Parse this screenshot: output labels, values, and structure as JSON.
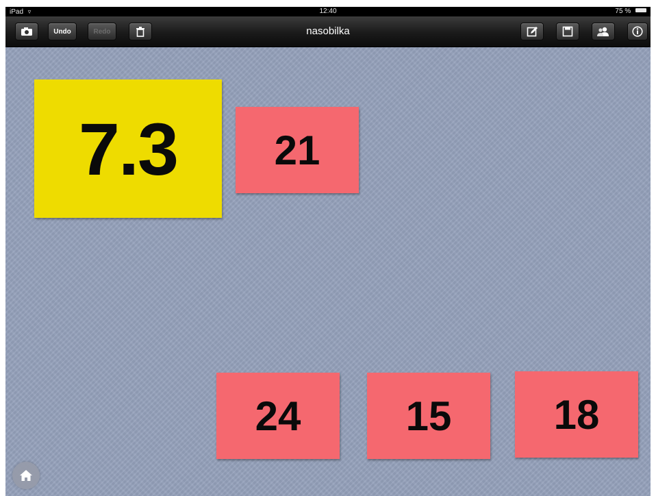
{
  "status_bar": {
    "device": "iPad",
    "time": "12:40",
    "battery": "75 %"
  },
  "toolbar": {
    "title": "nasobilka",
    "undo_label": "Undo",
    "redo_label": "Redo",
    "icons": [
      "camera-icon",
      "trash-icon",
      "edit-icon",
      "save-icon",
      "users-icon",
      "info-icon"
    ]
  },
  "board": {
    "question_card": "7.3",
    "answer_cards": [
      "21",
      "24",
      "15",
      "18"
    ]
  },
  "colors": {
    "question_card": "#eedc00",
    "answer_card": "#f5686f",
    "background": "#94a0ba"
  }
}
